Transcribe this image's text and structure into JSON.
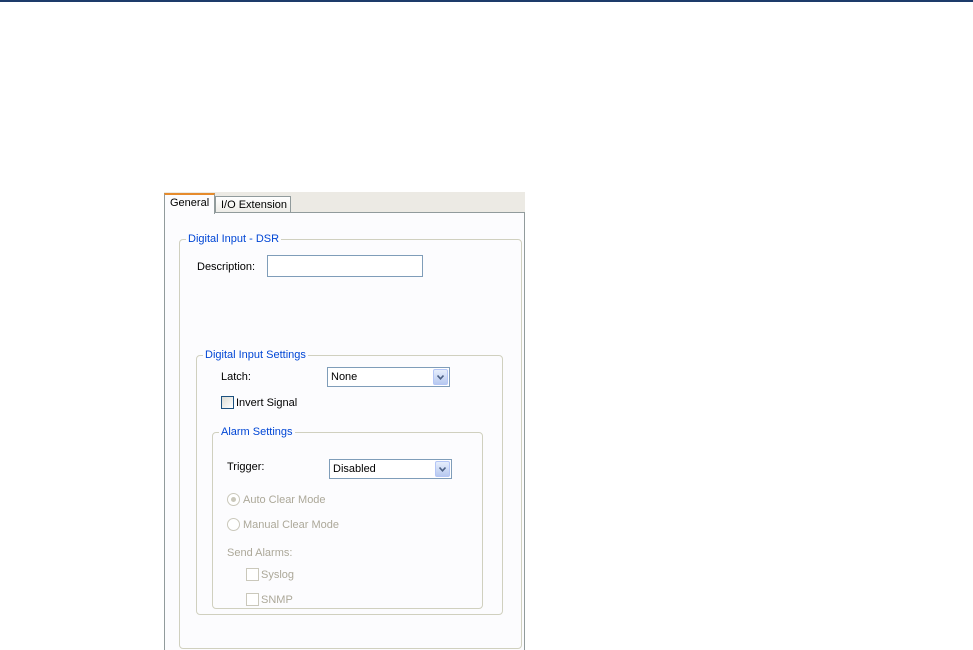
{
  "tabs": [
    {
      "label": "General",
      "active": true
    },
    {
      "label": "I/O Extension",
      "active": false
    }
  ],
  "digital_input_group": {
    "title": "Digital Input - DSR",
    "description_label": "Description:",
    "description_value": ""
  },
  "digital_input_settings": {
    "title": "Digital Input Settings",
    "latch_label": "Latch:",
    "latch_value": "None",
    "invert_signal_label": "Invert Signal",
    "invert_signal_checked": false
  },
  "alarm_settings": {
    "title": "Alarm Settings",
    "trigger_label": "Trigger:",
    "trigger_value": "Disabled",
    "auto_clear_label": "Auto Clear Mode",
    "manual_clear_label": "Manual Clear Mode",
    "send_alarms_label": "Send Alarms:",
    "syslog_label": "Syslog",
    "snmp_label": "SNMP"
  },
  "colors": {
    "accent_tab": "#e68b2c",
    "group_title": "#0046d5",
    "disabled_text": "#aca899",
    "top_rule": "#1d3b6a"
  }
}
